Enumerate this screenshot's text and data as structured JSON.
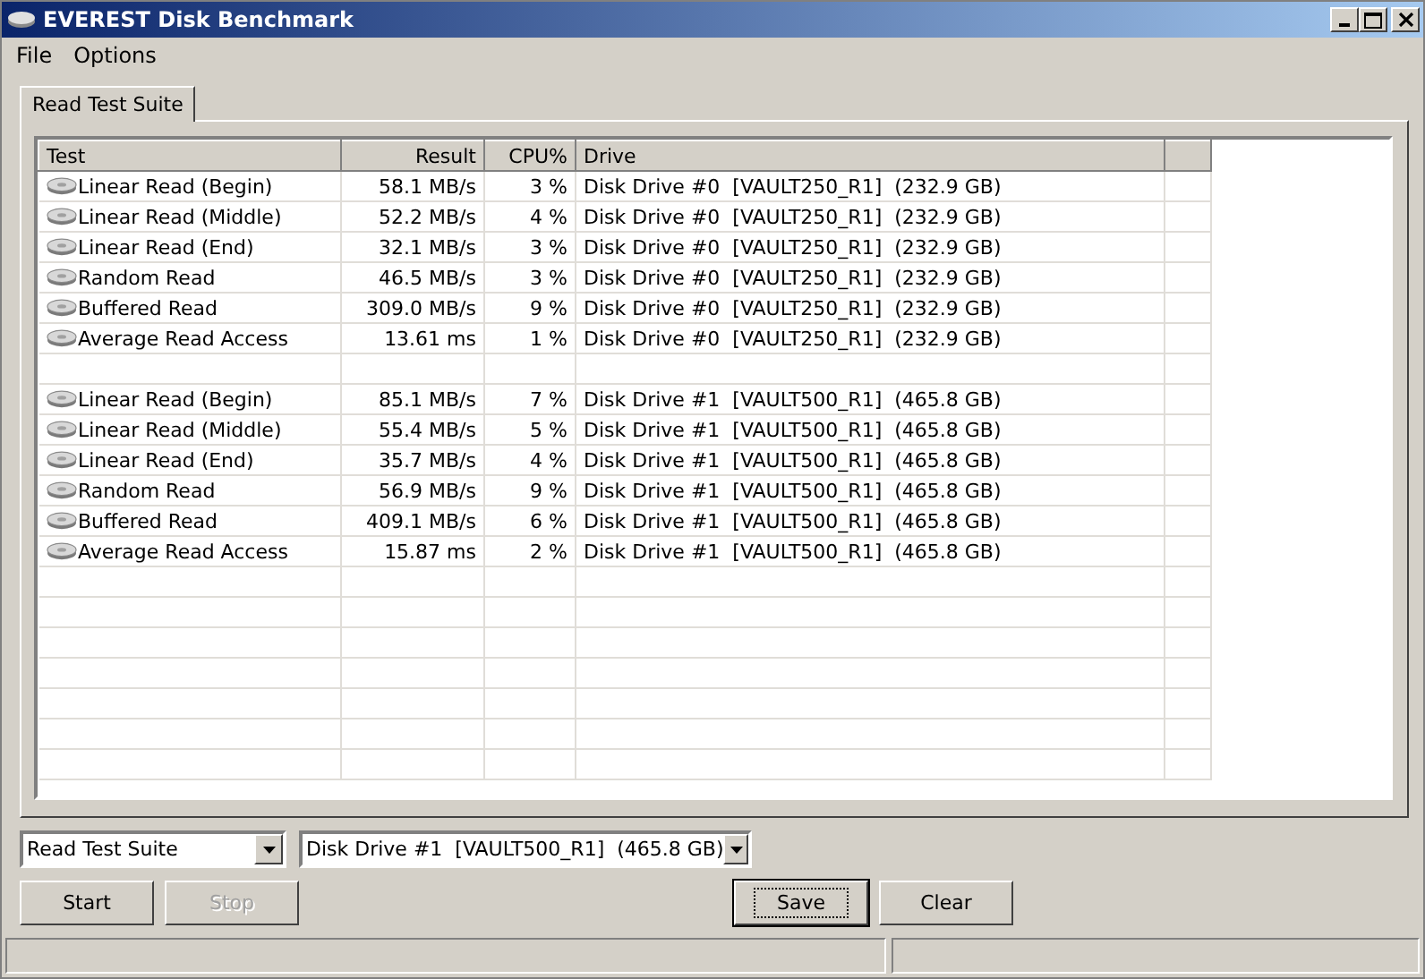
{
  "window": {
    "title": "EVEREST Disk Benchmark"
  },
  "menu": [
    "File",
    "Options"
  ],
  "tabs": [
    {
      "label": "Read Test Suite",
      "selected": true
    }
  ],
  "table": {
    "columns": [
      "Test",
      "Result",
      "CPU%",
      "Drive"
    ],
    "row_groups": [
      {
        "rows": [
          {
            "test": "Linear Read (Begin)",
            "result": "58.1 MB/s",
            "cpu": "3 %",
            "drive": "Disk Drive #0  [VAULT250_R1]  (232.9 GB)"
          },
          {
            "test": "Linear Read (Middle)",
            "result": "52.2 MB/s",
            "cpu": "4 %",
            "drive": "Disk Drive #0  [VAULT250_R1]  (232.9 GB)"
          },
          {
            "test": "Linear Read (End)",
            "result": "32.1 MB/s",
            "cpu": "3 %",
            "drive": "Disk Drive #0  [VAULT250_R1]  (232.9 GB)"
          },
          {
            "test": "Random Read",
            "result": "46.5 MB/s",
            "cpu": "3 %",
            "drive": "Disk Drive #0  [VAULT250_R1]  (232.9 GB)"
          },
          {
            "test": "Buffered Read",
            "result": "309.0 MB/s",
            "cpu": "9 %",
            "drive": "Disk Drive #0  [VAULT250_R1]  (232.9 GB)"
          },
          {
            "test": "Average Read Access",
            "result": "13.61 ms",
            "cpu": "1 %",
            "drive": "Disk Drive #0  [VAULT250_R1]  (232.9 GB)"
          }
        ]
      },
      {
        "rows": [
          {
            "test": "Linear Read (Begin)",
            "result": "85.1 MB/s",
            "cpu": "7 %",
            "drive": "Disk Drive #1  [VAULT500_R1]  (465.8 GB)"
          },
          {
            "test": "Linear Read (Middle)",
            "result": "55.4 MB/s",
            "cpu": "5 %",
            "drive": "Disk Drive #1  [VAULT500_R1]  (465.8 GB)"
          },
          {
            "test": "Linear Read (End)",
            "result": "35.7 MB/s",
            "cpu": "4 %",
            "drive": "Disk Drive #1  [VAULT500_R1]  (465.8 GB)"
          },
          {
            "test": "Random Read",
            "result": "56.9 MB/s",
            "cpu": "9 %",
            "drive": "Disk Drive #1  [VAULT500_R1]  (465.8 GB)"
          },
          {
            "test": "Buffered Read",
            "result": "409.1 MB/s",
            "cpu": "6 %",
            "drive": "Disk Drive #1  [VAULT500_R1]  (465.8 GB)"
          },
          {
            "test": "Average Read Access",
            "result": "15.87 ms",
            "cpu": "2 %",
            "drive": "Disk Drive #1  [VAULT500_R1]  (465.8 GB)"
          }
        ]
      }
    ]
  },
  "selectors": [
    {
      "value": "Read Test Suite"
    },
    {
      "value": "Disk Drive #1  [VAULT500_R1]  (465.8 GB)"
    }
  ],
  "buttons": [
    {
      "label": "Start",
      "disabled": false,
      "default": false
    },
    {
      "label": "Stop",
      "disabled": true,
      "default": false
    },
    {
      "label": "Save",
      "disabled": false,
      "default": true
    },
    {
      "label": "Clear",
      "disabled": false,
      "default": false
    }
  ]
}
